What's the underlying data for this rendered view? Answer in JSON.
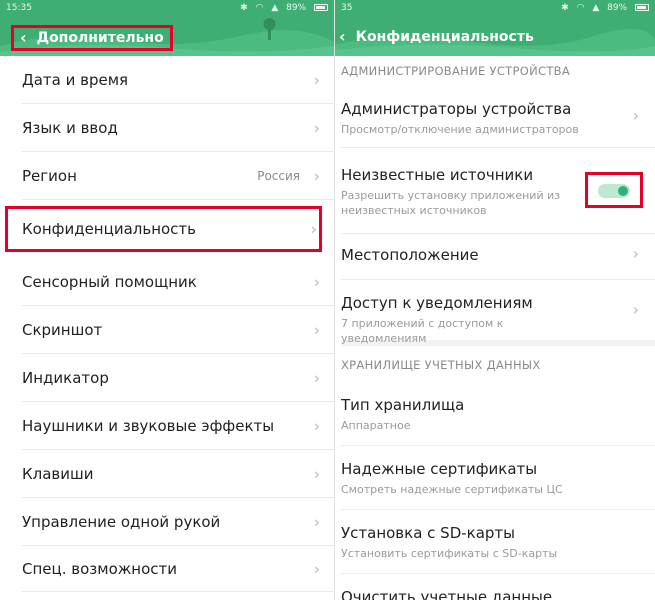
{
  "colors": {
    "header": "#3fae74",
    "highlight": "#e3002b",
    "toggle_on": "#2fb07a"
  },
  "left": {
    "status": {
      "time": "15:35",
      "battery": "89%"
    },
    "header": {
      "back_icon": "back-arrow-icon",
      "title": "Дополнительно"
    },
    "items": [
      {
        "label": "Дата и время"
      },
      {
        "label": "Язык и ввод"
      },
      {
        "label": "Регион",
        "value": "Россия"
      },
      {
        "label": "Конфиденциальность"
      },
      {
        "label": "Сенсорный помощник"
      },
      {
        "label": "Скриншот"
      },
      {
        "label": "Индикатор"
      },
      {
        "label": "Наушники и звуковые эффекты"
      },
      {
        "label": "Клавиши"
      },
      {
        "label": "Управление одной рукой"
      },
      {
        "label": "Спец. возможности"
      }
    ]
  },
  "right": {
    "status": {
      "time": "35",
      "battery": "89%"
    },
    "header": {
      "back_icon": "back-arrow-icon",
      "title": "Конфиденциальность"
    },
    "sections": {
      "device_admin": "АДМИНИСТРИРОВАНИЕ УСТРОЙСТВА",
      "credentials": "ХРАНИЛИЩЕ УЧЕТНЫХ ДАННЫХ"
    },
    "items": [
      {
        "title": "Администраторы устройства",
        "subtitle": "Просмотр/отключение администраторов"
      },
      {
        "title": "Неизвестные источники",
        "subtitle": "Разрешить установку приложений из неизвестных источников",
        "toggle": "on"
      },
      {
        "title": "Местоположение"
      },
      {
        "title": "Доступ к уведомлениям",
        "subtitle": "7 приложений с доступом к уведомлениям"
      },
      {
        "title": "Тип хранилища",
        "subtitle": "Аппаратное"
      },
      {
        "title": "Надежные сертификаты",
        "subtitle": "Смотреть надежные сертификаты ЦС"
      },
      {
        "title": "Установка с SD-карты",
        "subtitle": "Установить сертификаты с SD-карты"
      },
      {
        "title": "Очистить учетные данные"
      }
    ]
  }
}
